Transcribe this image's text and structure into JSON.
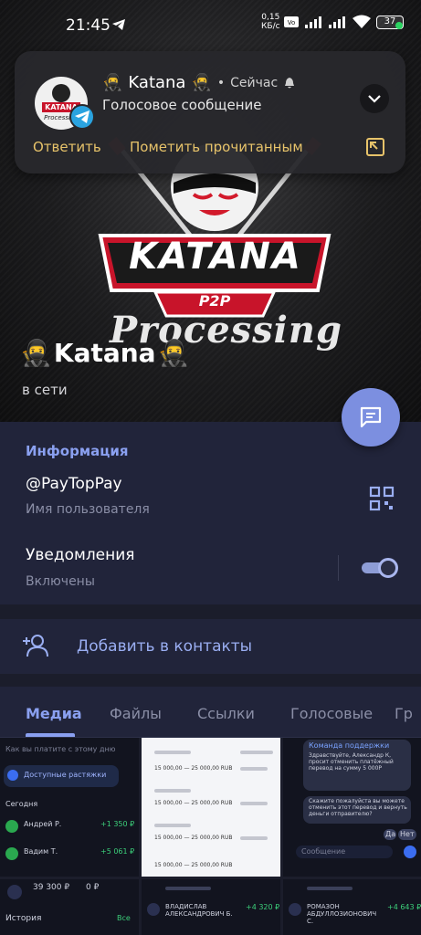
{
  "status_bar": {
    "time": "21:45",
    "net_speed": "0,15",
    "net_unit": "КБ/с",
    "battery": "37"
  },
  "notification": {
    "title": "Katana",
    "time": "Сейчас",
    "text": "Голосовое сообщение",
    "reply": "Ответить",
    "mark_read": "Пометить прочитанным",
    "avatar_text_top": "KATANA",
    "avatar_text_bottom": "Processing"
  },
  "profile": {
    "name": "Katana",
    "status": "в сети",
    "logo_main": "KATANA",
    "logo_sub": "P2P",
    "logo_script": "Processing"
  },
  "info": {
    "header": "Информация",
    "username": "@PayTopPay",
    "username_label": "Имя пользователя",
    "notifications": "Уведомления",
    "notifications_state": "Включены",
    "notifications_on": true
  },
  "add_contact": "Добавить в контакты",
  "tabs": [
    "Медиа",
    "Файлы",
    "Ссылки",
    "Голосовые",
    "Гр"
  ],
  "active_tab": 0,
  "media": {
    "t1": {
      "banner": "Как вы платите с этому дню",
      "promo": "Доступные растяжки",
      "today": "Сегодня",
      "row1_name": "Андрей Р.",
      "row1_amount": "+1 350 ₽",
      "row2_name": "Вадим Т.",
      "row2_amount": "+5 061 ₽",
      "bal1": "39 300 ₽",
      "bal2": "0 ₽",
      "history": "История",
      "all": "Все"
    },
    "t2": {
      "row_amount": "15 000,00 — 25 000,00 RUB"
    },
    "t3": {
      "sender": "Команда поддержки",
      "msg1": "Здравствуйте, Александр К, просит отменить платёжный перевод на сумму 5 000Р",
      "msg2": "Скажите пожалуйста вы можете отменить этот перевод и вернуть деньги отправителю?",
      "yes": "Да",
      "no": "Нет",
      "input": "Сообщение"
    },
    "t5": {
      "name": "ВЛАДИСЛАВ АЛЕКСАНДРОВИЧ Б.",
      "amount": "+4 320 ₽"
    },
    "t6": {
      "name": "РОМАЗОН АБДУЛЛОЗИОНОВИЧ С.",
      "amount": "+4 643 ₽"
    }
  }
}
